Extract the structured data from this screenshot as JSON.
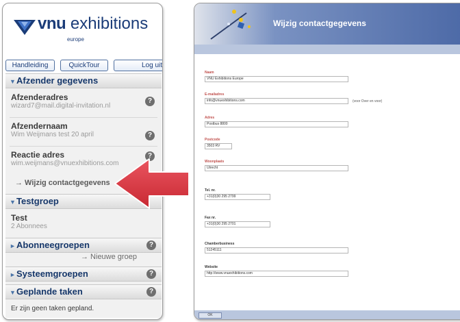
{
  "colors": {
    "accent_blue": "#1b3c78",
    "arrow_red": "#d2343f",
    "header_blue": "#4d6aa7"
  },
  "left": {
    "logo": {
      "word_bold": "vnu",
      "word": "exhibitions",
      "sub": "europe",
      "icon": "vnu-logo-icon"
    },
    "tabs": [
      "Handleiding",
      "QuickTour",
      "Log uit"
    ],
    "sections": {
      "afzender": {
        "header": "Afzender gegevens",
        "items": [
          {
            "title": "Afzenderadres",
            "sub": "wizard7@mail.digital-invitation.nl"
          },
          {
            "title": "Afzendernaam",
            "sub": "Wim Weijmans test 20 april"
          },
          {
            "title": "Reactie adres",
            "sub": "wim.weijmans@vnuexhibitions.com"
          }
        ],
        "link": "→ Wijzig contactgegevens"
      },
      "testgroep": {
        "header": "Testgroep",
        "item": {
          "title": "Test",
          "sub": "2 Abonnees"
        }
      },
      "abonneegroepen": {
        "header": "Abonneegroepen",
        "link": "→ Nieuwe groep"
      },
      "systeemgroepen": {
        "header": "Systeemgroepen"
      },
      "geplande": {
        "header": "Geplande taken",
        "text": "Er zijn geen taken gepland."
      }
    }
  },
  "right": {
    "title": "Wijzig contactgegevens",
    "fields": [
      {
        "label": "Naam",
        "value": "VNU Exhibitions Europe"
      },
      {
        "label": "E-mailadres",
        "value": "info@vnuexhibitions.com",
        "note": "(voor Over en voor)"
      },
      {
        "label": "Adres",
        "value": "Postbus 8800"
      },
      {
        "label": "Postcode",
        "value": "3503 RV"
      },
      {
        "label": "Woonplaats",
        "value": "Utrecht"
      },
      {
        "label": "Tel. nr.",
        "value": "+31(0)30 295 2799"
      },
      {
        "label": "Fax nr.",
        "value": "+31(0)30 295 2701"
      },
      {
        "label": "Chamberbusiness",
        "value": "51245111"
      },
      {
        "label": "Website",
        "value": "http://www.vnuexhibitions.com"
      }
    ],
    "ok_label": "OK"
  }
}
